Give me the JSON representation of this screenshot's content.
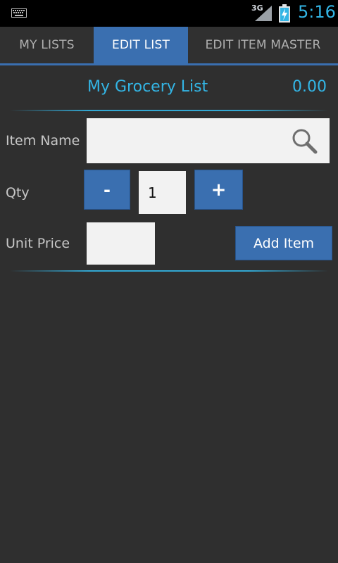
{
  "status_bar": {
    "network_type": "3G",
    "time": "5:16",
    "icons": [
      "keyboard-icon",
      "signal-icon",
      "battery-charging-icon"
    ]
  },
  "tabs": [
    {
      "label": "MY LISTS",
      "selected": false
    },
    {
      "label": "EDIT LIST",
      "selected": true
    },
    {
      "label": "EDIT ITEM MASTER",
      "selected": false
    }
  ],
  "list": {
    "title": "My Grocery List",
    "total": "0.00"
  },
  "form": {
    "item_name_label": "Item Name",
    "item_name_value": "",
    "qty_label": "Qty",
    "minus_label": "-",
    "qty_value": "1",
    "plus_label": "+",
    "unit_price_label": "Unit Price",
    "unit_price_value": "",
    "add_item_label": "Add Item"
  },
  "colors": {
    "accent": "#33b5e5",
    "button": "#3a6fb0",
    "background": "#2f2f2f",
    "status_bar": "#000000"
  }
}
